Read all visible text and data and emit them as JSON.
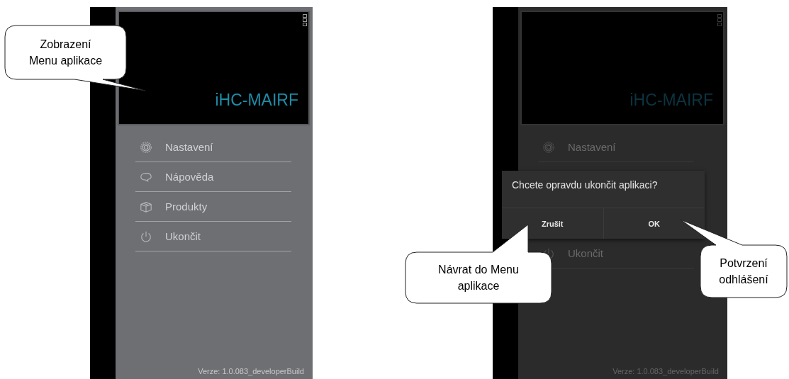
{
  "screens": [
    {
      "dimmed": false,
      "app_title": "iHC-MAIRF",
      "menu": [
        {
          "label": "Nastavení",
          "kind": "settings"
        },
        {
          "label": "Nápověda",
          "kind": "help"
        },
        {
          "label": "Produkty",
          "kind": "products"
        },
        {
          "label": "Ukončit",
          "kind": "quit"
        }
      ],
      "version": "Verze: 1.0.083_developerBuild"
    },
    {
      "dimmed": true,
      "app_title": "iHC-MAIRF",
      "menu": [
        {
          "label": "Nastavení",
          "kind": "settings"
        },
        {
          "label": "Ukončit",
          "kind": "quit"
        }
      ],
      "dialog": {
        "message": "Chcete opravdu ukončit aplikaci?",
        "buttons": [
          "Zrušit",
          "OK"
        ]
      },
      "version": "Verze: 1.0.083_developerBuild"
    }
  ],
  "callouts": [
    {
      "text": "Zobrazení Menu aplikace"
    },
    {
      "text": "Návrat do Menu aplikace"
    },
    {
      "text": "Potvrzení odhlášení"
    }
  ]
}
